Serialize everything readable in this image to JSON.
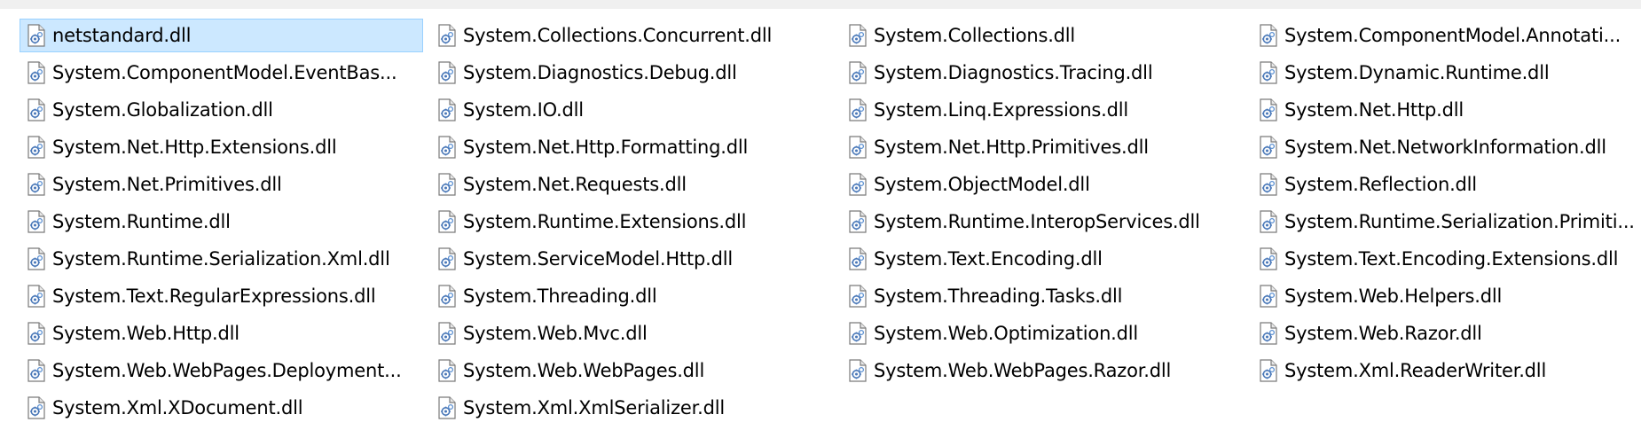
{
  "explorer": {
    "files": [
      {
        "name": "netstandard.dll",
        "selected": true
      },
      {
        "name": "System.ComponentModel.EventBas..."
      },
      {
        "name": "System.Globalization.dll"
      },
      {
        "name": "System.Net.Http.Extensions.dll"
      },
      {
        "name": "System.Net.Primitives.dll"
      },
      {
        "name": "System.Runtime.dll"
      },
      {
        "name": "System.Runtime.Serialization.Xml.dll"
      },
      {
        "name": "System.Text.RegularExpressions.dll"
      },
      {
        "name": "System.Web.Http.dll"
      },
      {
        "name": "System.Web.WebPages.Deployment..."
      },
      {
        "name": "System.Xml.XDocument.dll"
      },
      {
        "name": "System.Collections.Concurrent.dll"
      },
      {
        "name": "System.Diagnostics.Debug.dll"
      },
      {
        "name": "System.IO.dll"
      },
      {
        "name": "System.Net.Http.Formatting.dll"
      },
      {
        "name": "System.Net.Requests.dll"
      },
      {
        "name": "System.Runtime.Extensions.dll"
      },
      {
        "name": "System.ServiceModel.Http.dll"
      },
      {
        "name": "System.Threading.dll"
      },
      {
        "name": "System.Web.Mvc.dll"
      },
      {
        "name": "System.Web.WebPages.dll"
      },
      {
        "name": "System.Xml.XmlSerializer.dll"
      },
      {
        "name": "System.Collections.dll"
      },
      {
        "name": "System.Diagnostics.Tracing.dll"
      },
      {
        "name": "System.Linq.Expressions.dll"
      },
      {
        "name": "System.Net.Http.Primitives.dll"
      },
      {
        "name": "System.ObjectModel.dll"
      },
      {
        "name": "System.Runtime.InteropServices.dll"
      },
      {
        "name": "System.Text.Encoding.dll"
      },
      {
        "name": "System.Threading.Tasks.dll"
      },
      {
        "name": "System.Web.Optimization.dll"
      },
      {
        "name": "System.Web.WebPages.Razor.dll"
      },
      {
        "name": ""
      },
      {
        "name": "System.ComponentModel.Annotati..."
      },
      {
        "name": "System.Dynamic.Runtime.dll"
      },
      {
        "name": "System.Net.Http.dll"
      },
      {
        "name": "System.Net.NetworkInformation.dll"
      },
      {
        "name": "System.Reflection.dll"
      },
      {
        "name": "System.Runtime.Serialization.Primiti..."
      },
      {
        "name": "System.Text.Encoding.Extensions.dll"
      },
      {
        "name": "System.Web.Helpers.dll"
      },
      {
        "name": "System.Web.Razor.dll"
      },
      {
        "name": "System.Xml.ReaderWriter.dll"
      }
    ],
    "icon": "dll-file-icon",
    "colors": {
      "selection_bg": "#cce8ff",
      "selection_border": "#99d1ff"
    }
  }
}
